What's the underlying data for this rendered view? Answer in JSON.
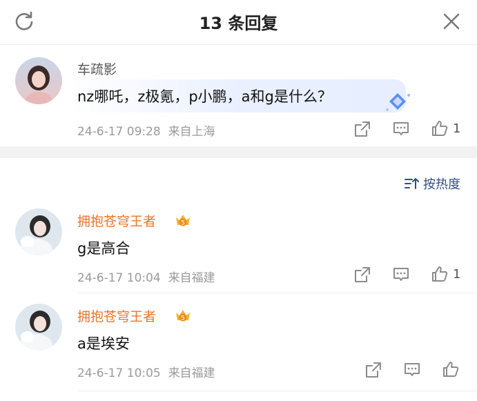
{
  "header": {
    "title": "13 条回复",
    "refresh_icon": "refresh-icon",
    "close_icon": "close-icon"
  },
  "main_comment": {
    "username": "车疏影",
    "text": "nz哪吒，z极氪，p小鹏，a和g是什么？",
    "time": "24-6-17 09:28",
    "location": "来自上海",
    "like_count": "1"
  },
  "sort": {
    "label": "按热度",
    "icon": "sort-icon"
  },
  "replies": [
    {
      "username": "拥抱苍穹王者",
      "badge_level": "5",
      "text": "g是高合",
      "time": "24-6-17 10:04",
      "location": "来自福建",
      "like_count": "1"
    },
    {
      "username": "拥抱苍穹王者",
      "badge_level": "5",
      "text": "a是埃安",
      "time": "24-6-17 10:05",
      "location": "来自福建",
      "like_count": ""
    }
  ],
  "colors": {
    "vip_name": "#e8742b",
    "normal_name": "#555555",
    "meta": "#9a9a9a",
    "sort_text": "#2f4f7f"
  }
}
